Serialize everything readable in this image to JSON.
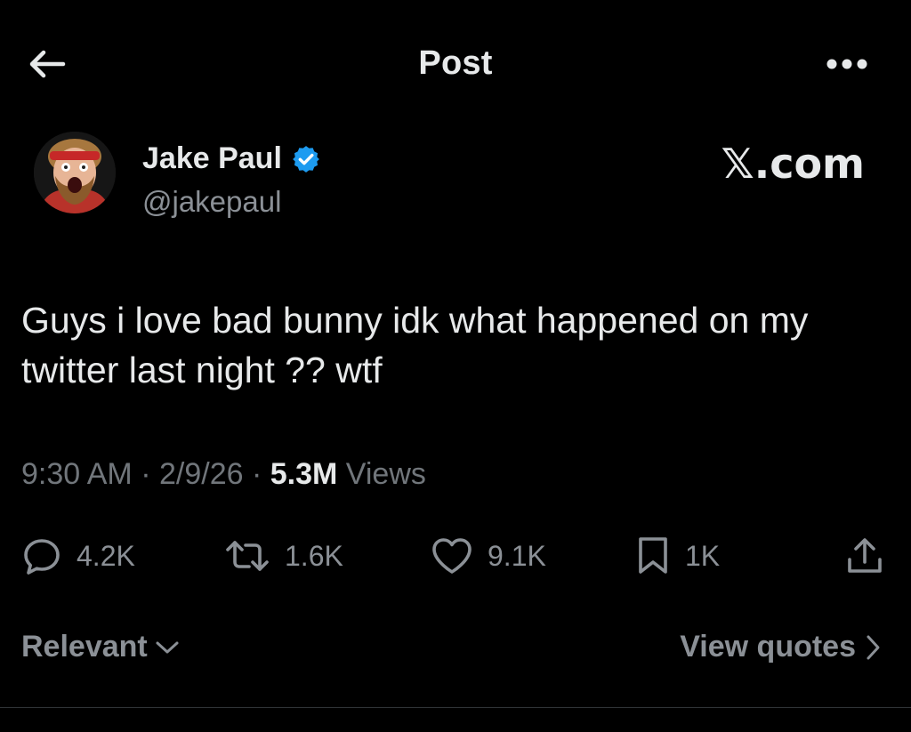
{
  "header": {
    "title": "Post",
    "back_icon": "arrow-left-icon",
    "more_icon": "more-horizontal-icon"
  },
  "author": {
    "name": "Jake Paul",
    "handle": "@jakepaul",
    "verified": true,
    "verified_color": "#1d9bf0"
  },
  "watermark": "𝕏.com",
  "post": {
    "text": "Guys i love bad bunny idk what happened on my twitter last night ?? wtf"
  },
  "meta": {
    "time": "9:30 AM",
    "separator": "·",
    "date": "2/9/26",
    "views_count": "5.3M",
    "views_label": "Views"
  },
  "actions": {
    "replies": "4.2K",
    "reposts": "1.6K",
    "likes": "9.1K",
    "bookmarks": "1K"
  },
  "footer": {
    "sort_label": "Relevant",
    "view_quotes_label": "View quotes"
  },
  "colors": {
    "background": "#000000",
    "text": "#e7e9ea",
    "muted": "#8b9096",
    "accent": "#1d9bf0"
  }
}
